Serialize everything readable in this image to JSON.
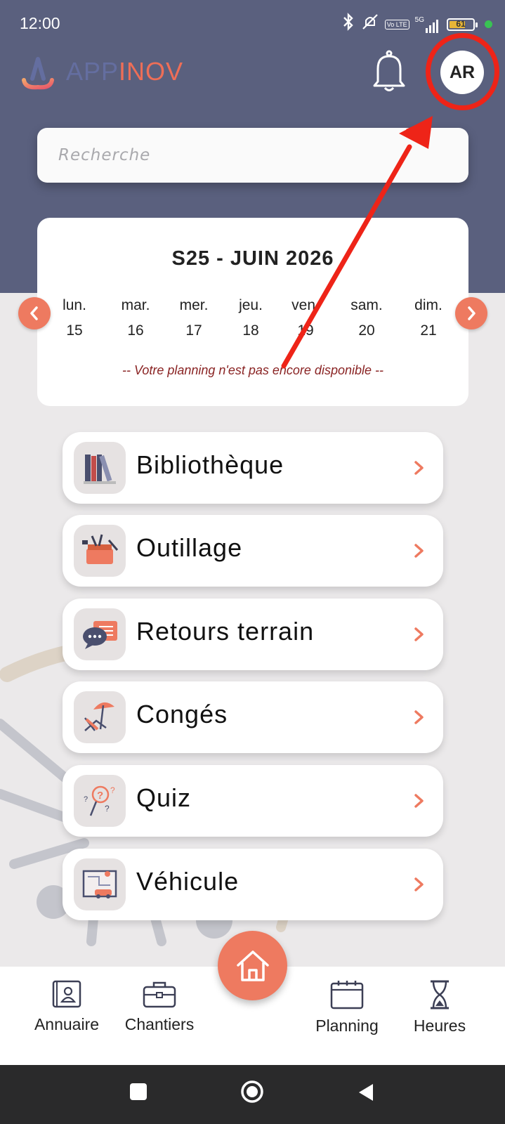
{
  "status_bar": {
    "time": "12:00",
    "volte_label": "Vo LTE",
    "network_label": "5G",
    "battery_level": "61"
  },
  "header": {
    "logo_part1": "APP",
    "logo_part2": "INOV",
    "avatar_initials": "AR"
  },
  "search": {
    "placeholder": "Recherche"
  },
  "calendar": {
    "title": "S25 - JUIN 2026",
    "days": [
      {
        "name": "lun.",
        "date": "15"
      },
      {
        "name": "mar.",
        "date": "16"
      },
      {
        "name": "mer.",
        "date": "17"
      },
      {
        "name": "jeu.",
        "date": "18"
      },
      {
        "name": "ven.",
        "date": "19"
      },
      {
        "name": "sam.",
        "date": "20"
      },
      {
        "name": "dim.",
        "date": "21"
      }
    ],
    "message": "-- Votre planning n'est pas encore disponible --"
  },
  "menu": {
    "items": [
      {
        "label": "Bibliothèque",
        "icon": "books-icon"
      },
      {
        "label": "Outillage",
        "icon": "toolbox-icon"
      },
      {
        "label": "Retours terrain",
        "icon": "chat-bubbles-icon"
      },
      {
        "label": "Congés",
        "icon": "beach-chair-icon"
      },
      {
        "label": "Quiz",
        "icon": "quiz-icon"
      },
      {
        "label": "Véhicule",
        "icon": "vehicle-map-icon"
      }
    ]
  },
  "bottom_nav": {
    "items": [
      {
        "label": "Annuaire",
        "icon": "contact-card-icon"
      },
      {
        "label": "Chantiers",
        "icon": "briefcase-icon"
      },
      {
        "label": "Planning",
        "icon": "calendar-icon"
      },
      {
        "label": "Heures",
        "icon": "hourglass-icon"
      }
    ],
    "home_icon": "home-icon"
  },
  "colors": {
    "header_bg": "#5a607e",
    "accent": "#ee7a60",
    "annotation_red": "#ee2418"
  }
}
